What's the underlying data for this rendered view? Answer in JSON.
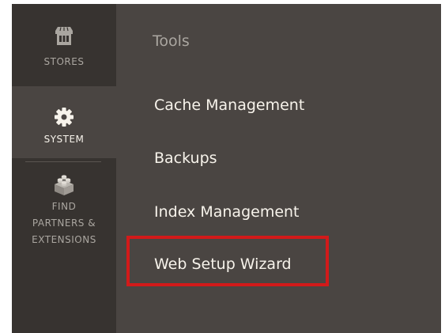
{
  "sidebar": {
    "items": [
      {
        "label": "STORES",
        "icon": "store-icon",
        "active": false
      },
      {
        "label": "SYSTEM",
        "icon": "gear-icon",
        "active": true
      },
      {
        "label_lines": [
          "FIND",
          "PARTNERS &",
          "EXTENSIONS"
        ],
        "icon": "lego-brick-icon",
        "active": false
      }
    ]
  },
  "panel": {
    "title": "Tools",
    "links": [
      "Cache Management",
      "Backups",
      "Index Management",
      "Web Setup Wizard"
    ],
    "highlighted_link": "Web Setup Wizard"
  },
  "colors": {
    "sidebar_bg": "#373330",
    "panel_bg": "#4a4542",
    "active_item_bg": "#4a4542",
    "link_text": "#f7f3eb",
    "muted_text": "#aaa6a0",
    "highlight_border": "#d21a1a"
  }
}
